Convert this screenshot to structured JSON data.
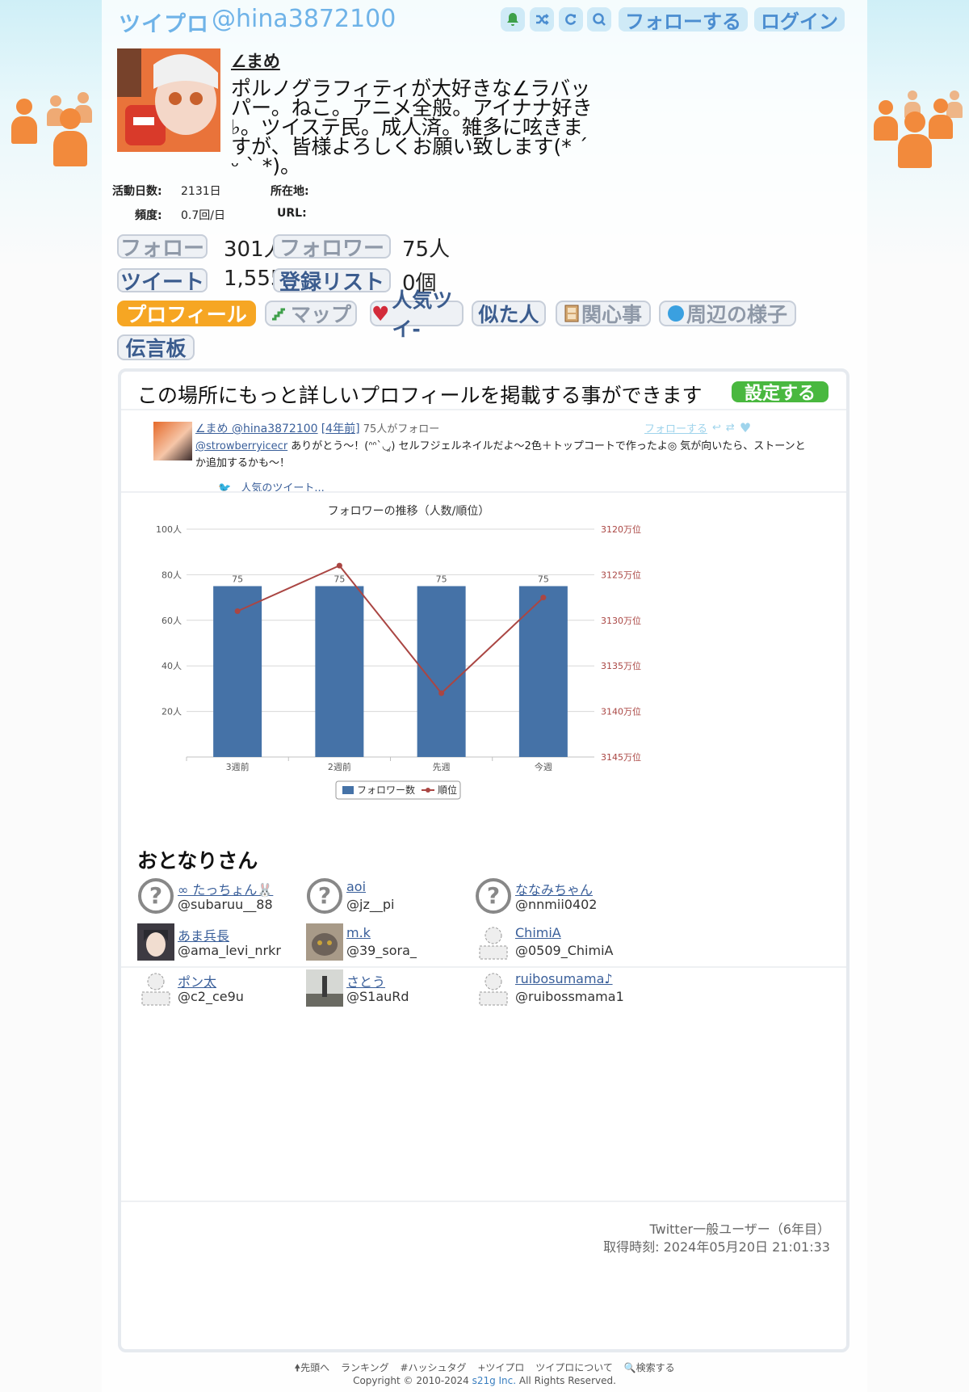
{
  "header": {
    "logo": "ツイプロ",
    "handle": "@hina3872100",
    "follow_label": "フォローする",
    "login_label": "ログイン"
  },
  "profile": {
    "name": "∠まめ",
    "bio": "ポルノグラフィティが大好きな∠ラバッパー。ねこ。アニメ全般。アイナナ好き♭。ツイステ民。成人済。雑多に呟きますが、皆様よろしくお願い致します(* ´ ᵕ ` *)。",
    "active_days_label": "活動日数:",
    "active_days_value": "2131日",
    "location_label": "所在地:",
    "location_value": "",
    "frequency_label": "頻度:",
    "frequency_value": "0.7回/日",
    "url_label": "URL:",
    "url_value": ""
  },
  "stats": {
    "follow_label": "フォロー",
    "follow_value": "301人",
    "follower_label": "フォロワー",
    "follower_value": "75人",
    "tweet_label": "ツイート",
    "tweet_value": "1,555",
    "list_label": "登録リスト",
    "list_value": "0個"
  },
  "tabs": [
    "プロフィール",
    "マップ",
    "人気ツイ-",
    "似た人",
    "関心事",
    "周辺の様子",
    "伝言板"
  ],
  "promo": {
    "text": "この場所にもっと詳しいプロフィールを掲載する事ができます",
    "button": "設定する"
  },
  "tweet": {
    "author": "∠まめ @hina3872100",
    "age": "[4年前]",
    "followers": "75人がフォロー",
    "follow_link": "フォローする",
    "mention": "@strowberryicecr",
    "body": " ありがとう～！(ᐢᐢ`◡͈) セルフジェルネイルだよ～2色＋トップコートで作ったよ◎ 気が向いたら、ストーンとか追加するかも～！",
    "popular_link": "人気のツイート..."
  },
  "chart_data": {
    "type": "bar",
    "title": "フォロワーの推移（人数/順位）",
    "categories": [
      "3週前",
      "2週前",
      "先週",
      "今週"
    ],
    "series": [
      {
        "name": "フォロワー数",
        "type": "bar",
        "axis": "left",
        "values": [
          75,
          75,
          75,
          75
        ],
        "color": "#4572a7"
      },
      {
        "name": "順位",
        "type": "line",
        "axis": "right",
        "values": [
          3129,
          3124,
          3138,
          3127.5
        ],
        "color": "#aa4643"
      }
    ],
    "left_axis": {
      "ylim": [
        0,
        100
      ],
      "ticks": [
        "20人",
        "40人",
        "60人",
        "80人",
        "100人"
      ]
    },
    "right_axis": {
      "ylim": [
        3120,
        3145
      ],
      "reversed": true,
      "ticks": [
        "3120万位",
        "3125万位",
        "3130万位",
        "3135万位",
        "3140万位",
        "3145万位"
      ]
    },
    "legend": "bottom-center",
    "grid": true
  },
  "neighbors": {
    "title": "おとなりさん",
    "items": [
      {
        "name": "∞ たっちょん🐰",
        "screen": "@subaruu__88",
        "icon": "question-icon"
      },
      {
        "name": "aoi",
        "screen": "@jz__pi",
        "icon": "question-icon"
      },
      {
        "name": "ななみちゃん",
        "screen": "@nnmii0402",
        "icon": "question-icon"
      },
      {
        "name": "あま兵長",
        "screen": "@ama_levi_nrkr",
        "icon": "anime-avatar"
      },
      {
        "name": "m.k",
        "screen": "@39_sora_",
        "icon": "cat-avatar"
      },
      {
        "name": "ChimiA",
        "screen": "@0509_ChimiA",
        "icon": "default-person-icon"
      },
      {
        "name": "ポン太",
        "screen": "@c2_ce9u",
        "icon": "default-person-icon"
      },
      {
        "name": "さとう",
        "screen": "@S1auRd",
        "icon": "tower-photo"
      },
      {
        "name": "ruibosumama♪",
        "screen": "@ruibossmama1",
        "icon": "default-person-icon"
      }
    ]
  },
  "status": {
    "user_type": "Twitter一般ユーザー（6年目）",
    "fetched": "取得時刻: 2024年05月20日 21:01:33"
  },
  "footer": {
    "links": [
      "先頭へ",
      "ランキング",
      "#ハッシュタグ",
      "+ツイプロ",
      "ツイプロについて",
      "検索する"
    ],
    "copyright_pre": "Copyright © 2010-2024 ",
    "company": "s21g Inc.",
    "copyright_post": " All Rights Reserved."
  }
}
